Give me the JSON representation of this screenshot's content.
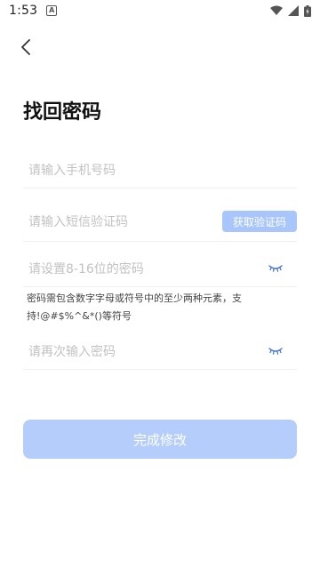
{
  "status_bar": {
    "time": "1:53",
    "notification_icon": "a-icon"
  },
  "header": {
    "back_icon": "chevron-left-icon",
    "title": "找回密码"
  },
  "form": {
    "phone_placeholder": "请输入手机号码",
    "sms_placeholder": "请输入短信验证码",
    "sms_button_label": "获取验证码",
    "password_placeholder": "请设置8-16位的密码",
    "password_hint": "密码需包含数字字母或符号中的至少两种元素，支持!@#$%^&*()等符号",
    "confirm_placeholder": "请再次输入密码",
    "eye_icon": "eye-closed-icon",
    "submit_label": "完成修改"
  },
  "colors": {
    "accent_disabled": "#b4cdfb",
    "sms_button": "#a8c6fb",
    "eye_icon": "#3f6fd8"
  }
}
